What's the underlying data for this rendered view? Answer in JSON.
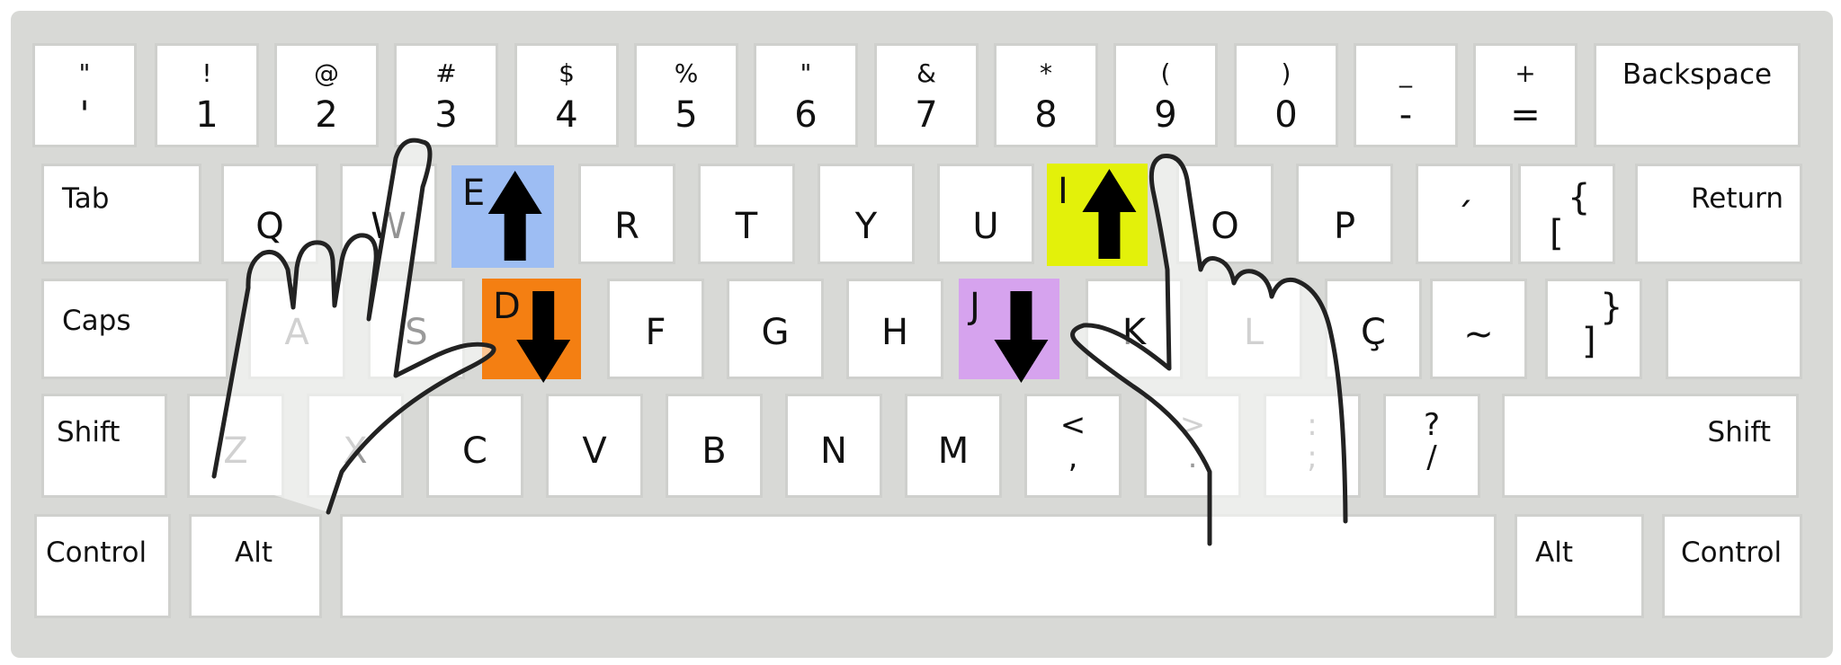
{
  "colors": {
    "frame": "#d8d9d6",
    "key_face": "#ffffff",
    "key_border": "#cfd0cd",
    "label": "#111111",
    "faded_label": "#9a9a9a",
    "e_key": "#9dbdf3",
    "i_key": "#e3f10a",
    "d_key": "#f47f12",
    "j_key": "#d6a3ee",
    "arrow": "#000000",
    "hand_outline": "#222222"
  },
  "keyboard": {
    "row_numbers": [
      {
        "top": "\"",
        "bottom": "'"
      },
      {
        "top": "!",
        "bottom": "1"
      },
      {
        "top": "@",
        "bottom": "2"
      },
      {
        "top": "#",
        "bottom": "3"
      },
      {
        "top": "$",
        "bottom": "4"
      },
      {
        "top": "%",
        "bottom": "5"
      },
      {
        "top": "\"",
        "bottom": "6"
      },
      {
        "top": "&",
        "bottom": "7"
      },
      {
        "top": "*",
        "bottom": "8"
      },
      {
        "top": "(",
        "bottom": "9"
      },
      {
        "top": ")",
        "bottom": "0"
      },
      {
        "top": "_",
        "bottom": "-"
      },
      {
        "top": "+",
        "bottom": "="
      }
    ],
    "backspace": "Backspace",
    "tab": "Tab",
    "row_top": [
      "Q",
      "W",
      "E",
      "R",
      "T",
      "Y",
      "U",
      "I",
      "O",
      "P"
    ],
    "acute": {
      "top": "",
      "bottom": "´"
    },
    "brace_open": {
      "top": "{",
      "bottom": "["
    },
    "return": "Return",
    "caps": "Caps",
    "row_home": [
      "A",
      "S",
      "D",
      "F",
      "G",
      "H",
      "J",
      "K",
      "L",
      "Ç"
    ],
    "tilde": "~",
    "brace_close": {
      "top": "}",
      "bottom": "]"
    },
    "shift_left": "Shift",
    "row_bottom": [
      "Z",
      "X",
      "C",
      "V",
      "B",
      "N",
      "M"
    ],
    "punct": [
      {
        "top": "<",
        "bottom": ","
      },
      {
        "top": ">",
        "bottom": "."
      },
      {
        "top": ":",
        "bottom": ";"
      },
      {
        "top": "?",
        "bottom": "/"
      }
    ],
    "shift_right": "Shift",
    "control_left": "Control",
    "alt_left": "Alt",
    "alt_right": "Alt",
    "control_right": "Control"
  },
  "highlights": [
    {
      "key": "E",
      "color": "#9dbdf3",
      "arrow": "up"
    },
    {
      "key": "I",
      "color": "#e3f10a",
      "arrow": "up"
    },
    {
      "key": "D",
      "color": "#f47f12",
      "arrow": "down"
    },
    {
      "key": "J",
      "color": "#d6a3ee",
      "arrow": "down"
    }
  ],
  "hands": {
    "left": "pointing-hand-left-icon",
    "right": "pointing-hand-right-icon"
  }
}
